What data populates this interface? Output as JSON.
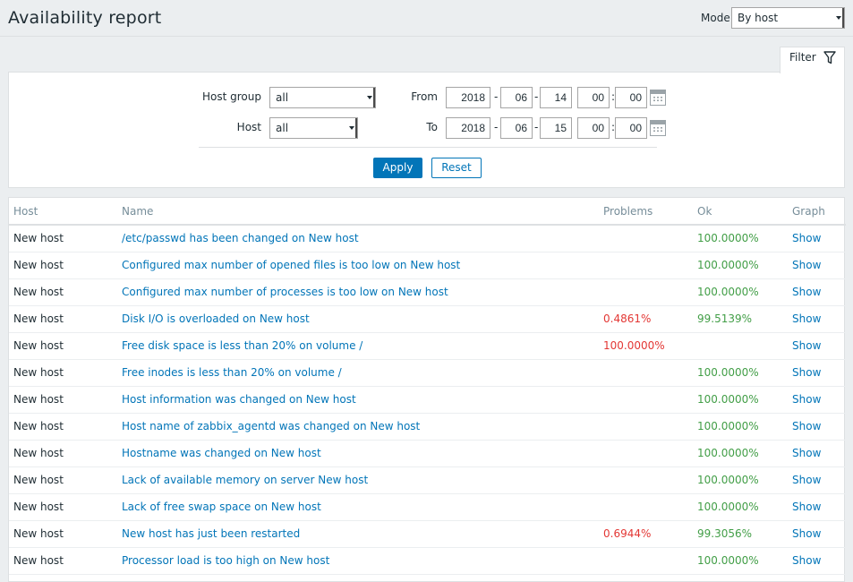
{
  "header": {
    "title": "Availability report",
    "mode_label": "Mode",
    "mode_value": "By host"
  },
  "filter": {
    "tab_label": "Filter",
    "host_group_label": "Host group",
    "host_group_value": "all",
    "host_label": "Host",
    "host_value": "all",
    "from_label": "From",
    "from": {
      "year": "2018",
      "month": "06",
      "day": "14",
      "hour": "00",
      "minute": "00"
    },
    "to_label": "To",
    "to": {
      "year": "2018",
      "month": "06",
      "day": "15",
      "hour": "00",
      "minute": "00"
    },
    "apply_label": "Apply",
    "reset_label": "Reset"
  },
  "table": {
    "headers": {
      "host": "Host",
      "name": "Name",
      "problems": "Problems",
      "ok": "Ok",
      "graph": "Graph"
    },
    "rows": [
      {
        "host": "New host",
        "name": "/etc/passwd has been changed on New host",
        "problems": "",
        "ok": "100.0000%",
        "graph": "Show"
      },
      {
        "host": "New host",
        "name": "Configured max number of opened files is too low on New host",
        "problems": "",
        "ok": "100.0000%",
        "graph": "Show"
      },
      {
        "host": "New host",
        "name": "Configured max number of processes is too low on New host",
        "problems": "",
        "ok": "100.0000%",
        "graph": "Show"
      },
      {
        "host": "New host",
        "name": "Disk I/O is overloaded on New host",
        "problems": "0.4861%",
        "ok": "99.5139%",
        "graph": "Show"
      },
      {
        "host": "New host",
        "name": "Free disk space is less than 20% on volume /",
        "problems": "100.0000%",
        "ok": "",
        "graph": "Show"
      },
      {
        "host": "New host",
        "name": "Free inodes is less than 20% on volume /",
        "problems": "",
        "ok": "100.0000%",
        "graph": "Show"
      },
      {
        "host": "New host",
        "name": "Host information was changed on New host",
        "problems": "",
        "ok": "100.0000%",
        "graph": "Show"
      },
      {
        "host": "New host",
        "name": "Host name of zabbix_agentd was changed on New host",
        "problems": "",
        "ok": "100.0000%",
        "graph": "Show"
      },
      {
        "host": "New host",
        "name": "Hostname was changed on New host",
        "problems": "",
        "ok": "100.0000%",
        "graph": "Show"
      },
      {
        "host": "New host",
        "name": "Lack of available memory on server New host",
        "problems": "",
        "ok": "100.0000%",
        "graph": "Show"
      },
      {
        "host": "New host",
        "name": "Lack of free swap space on New host",
        "problems": "",
        "ok": "100.0000%",
        "graph": "Show"
      },
      {
        "host": "New host",
        "name": "New host has just been restarted",
        "problems": "0.6944%",
        "ok": "99.3056%",
        "graph": "Show"
      },
      {
        "host": "New host",
        "name": "Processor load is too high on New host",
        "problems": "",
        "ok": "100.0000%",
        "graph": "Show"
      }
    ]
  },
  "colors": {
    "link": "#0275b8",
    "problem": "#e33734",
    "ok": "#429e47",
    "accent": "#0275b8"
  },
  "icons": {
    "filter": "funnel-icon",
    "calendar": "calendar-icon"
  }
}
